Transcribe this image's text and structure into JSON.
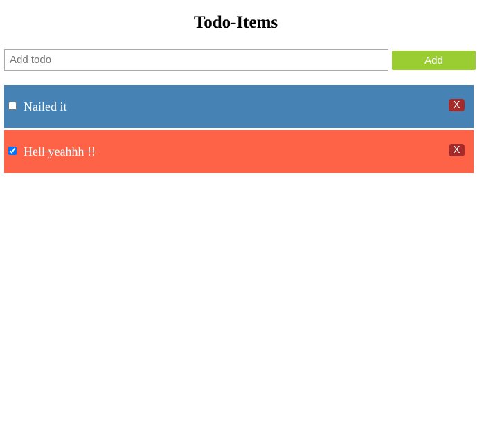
{
  "header": {
    "title": "Todo-Items"
  },
  "add_form": {
    "input_value": "",
    "input_placeholder": "Add todo",
    "add_label": "Add"
  },
  "todos": [
    {
      "text": "Nailed it",
      "completed": false,
      "delete_label": "X"
    },
    {
      "text": "Hell yeahhh !!",
      "completed": true,
      "delete_label": "X"
    }
  ],
  "colors": {
    "add_button": "#9acd32",
    "item_active": "#4682b4",
    "item_completed": "#ff6347",
    "delete_button": "#a52a2a"
  }
}
